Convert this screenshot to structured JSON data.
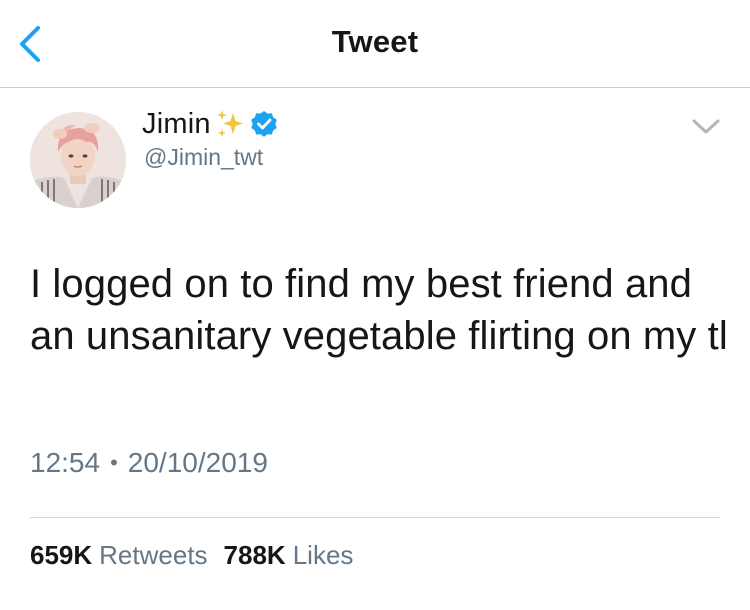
{
  "header": {
    "title": "Tweet",
    "back_icon": "chevron-left-icon"
  },
  "author": {
    "name": "Jimin",
    "handle": "@Jimin_twt",
    "emoji_icon": "sparkles-icon",
    "verified_icon": "verified-badge-icon"
  },
  "tweet": {
    "text": "I logged on to find my best friend and an unsanitary vegetable flirting on my tl",
    "time": "12:54",
    "separator": "•",
    "date": "20/10/2019"
  },
  "stats": {
    "retweets_count": "659K",
    "retweets_label": "Retweets",
    "likes_count": "788K",
    "likes_label": "Likes"
  },
  "colors": {
    "accent": "#1DA1F2",
    "text": "#14171a",
    "secondary_text": "#657786",
    "divider": "#d3d8dc"
  }
}
